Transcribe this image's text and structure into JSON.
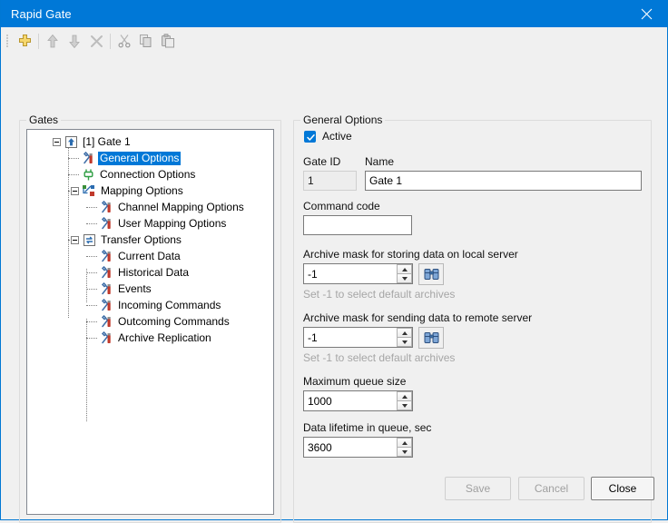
{
  "window": {
    "title": "Rapid Gate",
    "close_icon": "close-icon",
    "accent_color": "#0078d7",
    "background_color": "#f0f0f0"
  },
  "toolbar": {
    "items": [
      {
        "name": "add-button",
        "icon": "plus-icon",
        "tooltip": "Add"
      },
      {
        "name": "move-up-button",
        "icon": "arrow-up-icon",
        "tooltip": "Move up"
      },
      {
        "name": "move-down-button",
        "icon": "arrow-down-icon",
        "tooltip": "Move down"
      },
      {
        "name": "delete-button",
        "icon": "close-x-icon",
        "tooltip": "Delete"
      },
      {
        "name": "cut-button",
        "icon": "scissors-icon",
        "tooltip": "Cut"
      },
      {
        "name": "copy-button",
        "icon": "copy-icon",
        "tooltip": "Copy"
      },
      {
        "name": "paste-button",
        "icon": "paste-icon",
        "tooltip": "Paste"
      }
    ]
  },
  "gates_panel": {
    "legend": "Gates",
    "tree": [
      {
        "label": "[1] Gate 1",
        "icon": "gate-arrow-up-icon",
        "level": 0,
        "expandable": true,
        "selected": false
      },
      {
        "label": "General Options",
        "icon": "tools-icon",
        "level": 1,
        "expandable": false,
        "selected": true
      },
      {
        "label": "Connection Options",
        "icon": "plug-icon",
        "level": 1,
        "expandable": false,
        "selected": false
      },
      {
        "label": "Mapping Options",
        "icon": "mapping-icon",
        "level": 1,
        "expandable": true,
        "selected": false
      },
      {
        "label": "Channel Mapping Options",
        "icon": "tools-icon",
        "level": 2,
        "expandable": false,
        "selected": false
      },
      {
        "label": "User Mapping Options",
        "icon": "tools-icon",
        "level": 2,
        "expandable": false,
        "selected": false
      },
      {
        "label": "Transfer Options",
        "icon": "transfer-arrows-icon",
        "level": 1,
        "expandable": true,
        "selected": false
      },
      {
        "label": "Current Data",
        "icon": "tools-icon",
        "level": 2,
        "expandable": false,
        "selected": false
      },
      {
        "label": "Historical Data",
        "icon": "tools-icon",
        "level": 2,
        "expandable": false,
        "selected": false
      },
      {
        "label": "Events",
        "icon": "tools-icon",
        "level": 2,
        "expandable": false,
        "selected": false
      },
      {
        "label": "Incoming Commands",
        "icon": "tools-icon",
        "level": 2,
        "expandable": false,
        "selected": false
      },
      {
        "label": "Outcoming Commands",
        "icon": "tools-icon",
        "level": 2,
        "expandable": false,
        "selected": false
      },
      {
        "label": "Archive Replication",
        "icon": "tools-icon",
        "level": 2,
        "expandable": false,
        "selected": false
      }
    ]
  },
  "general_options": {
    "legend": "General Options",
    "active": {
      "label": "Active",
      "checked": true
    },
    "gate_id": {
      "label": "Gate ID",
      "value": "1",
      "disabled": true
    },
    "name": {
      "label": "Name",
      "value": "Gate 1",
      "disabled": false
    },
    "command_code": {
      "label": "Command code",
      "value": "",
      "disabled": false
    },
    "archive_mask_local": {
      "label": "Archive mask for storing data on local server",
      "value": "-1",
      "hint": "Set -1 to select default archives",
      "browse_icon": "binoculars-icon"
    },
    "archive_mask_remote": {
      "label": "Archive mask for sending data to remote server",
      "value": "-1",
      "hint": "Set -1 to select default archives",
      "browse_icon": "binoculars-icon"
    },
    "max_queue_size": {
      "label": "Maximum queue size",
      "value": "1000"
    },
    "data_lifetime": {
      "label": "Data lifetime in queue, sec",
      "value": "3600"
    }
  },
  "footer": {
    "save": {
      "label": "Save",
      "enabled": false
    },
    "cancel": {
      "label": "Cancel",
      "enabled": false
    },
    "close": {
      "label": "Close",
      "enabled": true
    }
  }
}
